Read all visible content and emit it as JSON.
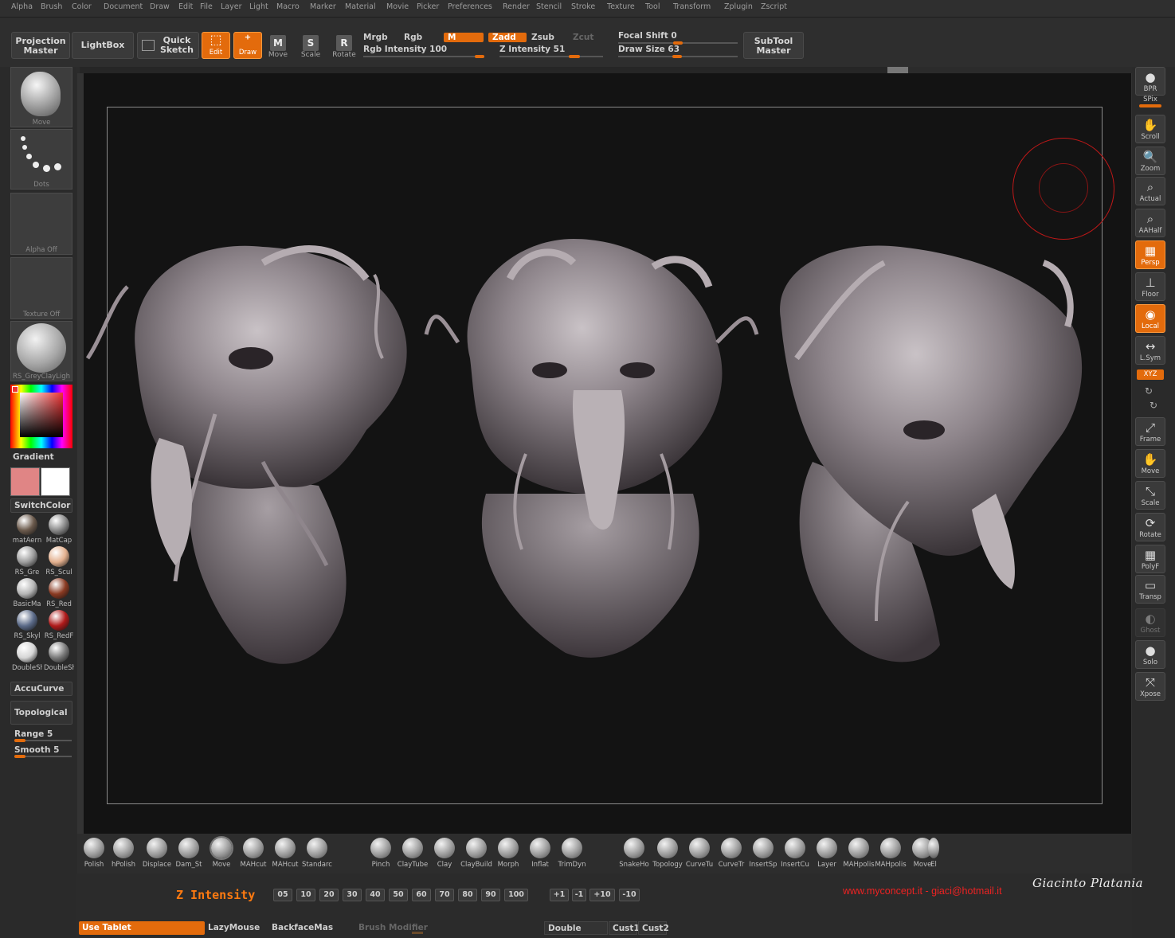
{
  "menu": [
    "Alpha",
    "Brush",
    "Color",
    "Document",
    "Draw",
    "Edit",
    "File",
    "Layer",
    "Light",
    "Macro",
    "Marker",
    "Material",
    "Movie",
    "Picker",
    "Preferences",
    "Render",
    "Stencil",
    "Stroke",
    "Texture",
    "Tool",
    "Transform",
    "Zplugin",
    "Zscript"
  ],
  "toolbar": {
    "projection_master": "Projection Master",
    "lightbox": "LightBox",
    "quick_sketch": "Quick Sketch",
    "edit": "Edit",
    "draw": "Draw",
    "move": "Move",
    "scale": "Scale",
    "rotate": "Rotate",
    "mrgb": "Mrgb",
    "rgb": "Rgb",
    "m": "M",
    "zadd": "Zadd",
    "zsub": "Zsub",
    "zcut": "Zcut",
    "rgb_intensity": "Rgb Intensity 100",
    "z_intensity": "Z Intensity 51",
    "focal_shift": "Focal Shift 0",
    "draw_size": "Draw Size 63",
    "subtool_master": "SubTool Master",
    "rgb_intensity_value": 100,
    "z_intensity_value": 51,
    "focal_shift_value": 0,
    "draw_size_value": 63
  },
  "left": {
    "brush_label": "Move",
    "stroke_label": "Dots",
    "alpha_label": "Alpha  Off",
    "texture_label": "Texture  Off",
    "material_label": "RS_GreyClayLigh",
    "gradient": "Gradient",
    "switch_color": "SwitchColor",
    "primary_color": "#e08585",
    "secondary_color": "#ffffff",
    "materials": [
      {
        "label": "matAern",
        "color": "#6b5a4c"
      },
      {
        "label": "MatCap",
        "color": "#8a8a8a"
      },
      {
        "label": "RS_Gre",
        "color": "#9c9c9c"
      },
      {
        "label": "RS_Scul",
        "color": "#e3b08e"
      },
      {
        "label": "BasicMa",
        "color": "#b5b5b5"
      },
      {
        "label": "RS_Red",
        "color": "#8a3a22"
      },
      {
        "label": "RS_Skyl",
        "color": "#5b6a88"
      },
      {
        "label": "RS_RedF",
        "color": "#b01a1a"
      },
      {
        "label": "DoubleSh",
        "color": "#d6d6d6"
      },
      {
        "label": "DoubleSh",
        "color": "#7a7a7a"
      }
    ],
    "accucurve": "AccuCurve",
    "topological": "Topological",
    "range": "Range 5",
    "smooth": "Smooth 5"
  },
  "right": [
    {
      "label": "BPR",
      "glyph": "●",
      "name": "bpr-button"
    },
    {
      "label": "Scroll",
      "glyph": "✋",
      "name": "scroll-button"
    },
    {
      "label": "Zoom",
      "glyph": "🔍",
      "name": "zoom-button"
    },
    {
      "label": "Actual",
      "glyph": "⌕",
      "name": "actual-button"
    },
    {
      "label": "AAHalf",
      "glyph": "⌕",
      "name": "aahalf-button"
    },
    {
      "label": "Persp",
      "glyph": "▦",
      "name": "persp-button",
      "active": true
    },
    {
      "label": "Floor",
      "glyph": "⊥",
      "name": "floor-button"
    },
    {
      "label": "Local",
      "glyph": "◉",
      "name": "local-button",
      "active": true
    },
    {
      "label": "L.Sym",
      "glyph": "↔",
      "name": "lsym-button"
    },
    {
      "label": "Frame",
      "glyph": "⤢",
      "name": "frame-button"
    },
    {
      "label": "Move",
      "glyph": "✋",
      "name": "move-view-button"
    },
    {
      "label": "Scale",
      "glyph": "⤡",
      "name": "scale-view-button"
    },
    {
      "label": "Rotate",
      "glyph": "⟳",
      "name": "rotate-view-button"
    },
    {
      "label": "PolyF",
      "glyph": "▦",
      "name": "polyf-button"
    },
    {
      "label": "Transp",
      "glyph": "▭",
      "name": "transp-button"
    },
    {
      "label": "Ghost",
      "glyph": "◐",
      "name": "ghost-button",
      "dim": true
    },
    {
      "label": "Solo",
      "glyph": "●",
      "name": "solo-button"
    },
    {
      "label": "Xpose",
      "glyph": "⤧",
      "name": "xpose-button"
    }
  ],
  "right_extra": {
    "spix": "SPix",
    "xyz": "XYZ"
  },
  "brushes": [
    "Polish",
    "hPolish",
    "Displace",
    "Dam_St",
    "Move",
    "MAHcut",
    "MAHcut",
    "Standarc",
    "Pinch",
    "ClayTube",
    "Clay",
    "ClayBuild",
    "Morph",
    "Inflat",
    "TrimDyn",
    "SnakeHo",
    "Topology",
    "CurveTu",
    "CurveTr",
    "InsertSp",
    "InsertCu",
    "Layer",
    "MAHpolis",
    "MAHpolis",
    "Move",
    "El"
  ],
  "bottom": {
    "z_intensity_label": "Z Intensity",
    "presets": [
      "05",
      "10",
      "20",
      "30",
      "40",
      "50",
      "60",
      "70",
      "80",
      "90",
      "100"
    ],
    "steps": [
      "+1",
      "-1",
      "+10",
      "-10"
    ],
    "credit": "www.myconcept.it - giaci@hotmail.it",
    "signature": "Giacinto Platania",
    "use_tablet": "Use Tablet",
    "lazymouse": "LazyMouse",
    "backface": "BackfaceMas",
    "brush_modifier": "Brush  Modifier",
    "double": "Double",
    "cust1": "Cust1",
    "cust2": "Cust2"
  }
}
